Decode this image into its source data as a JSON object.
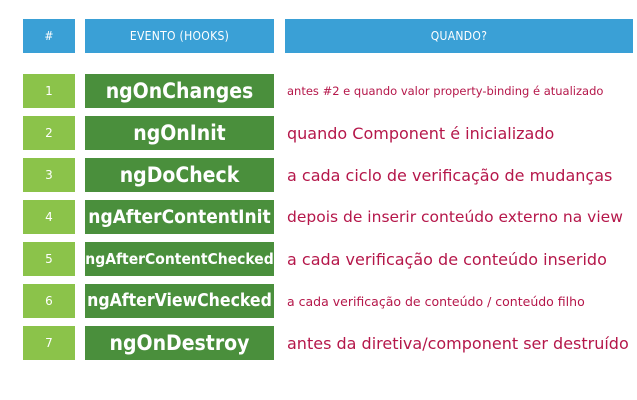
{
  "header": {
    "number": "#",
    "event": "EVENTO (HOOKS)",
    "when": "QUANDO?"
  },
  "colors": {
    "header_bg": "#3aa0d6",
    "number_bg": "#8bc34a",
    "hook_bg": "#4a8f3c",
    "description_text": "#b5174a"
  },
  "rows": [
    {
      "number": "1",
      "hook": "ngOnChanges",
      "description": "antes #2 e quando valor property-binding é atualizado"
    },
    {
      "number": "2",
      "hook": "ngOnInit",
      "description": "quando Component é inicializado"
    },
    {
      "number": "3",
      "hook": "ngDoCheck",
      "description": "a cada ciclo de verificação de mudanças"
    },
    {
      "number": "4",
      "hook": "ngAfterContentInit",
      "description": "depois de inserir conteúdo externo na view"
    },
    {
      "number": "5",
      "hook": "ngAfterContentChecked",
      "description": "a cada verificação de conteúdo inserido"
    },
    {
      "number": "6",
      "hook": "ngAfterViewChecked",
      "description": "a cada verificação de conteúdo / conteúdo filho"
    },
    {
      "number": "7",
      "hook": "ngOnDestroy",
      "description": "antes da diretiva/component ser destruído"
    }
  ]
}
